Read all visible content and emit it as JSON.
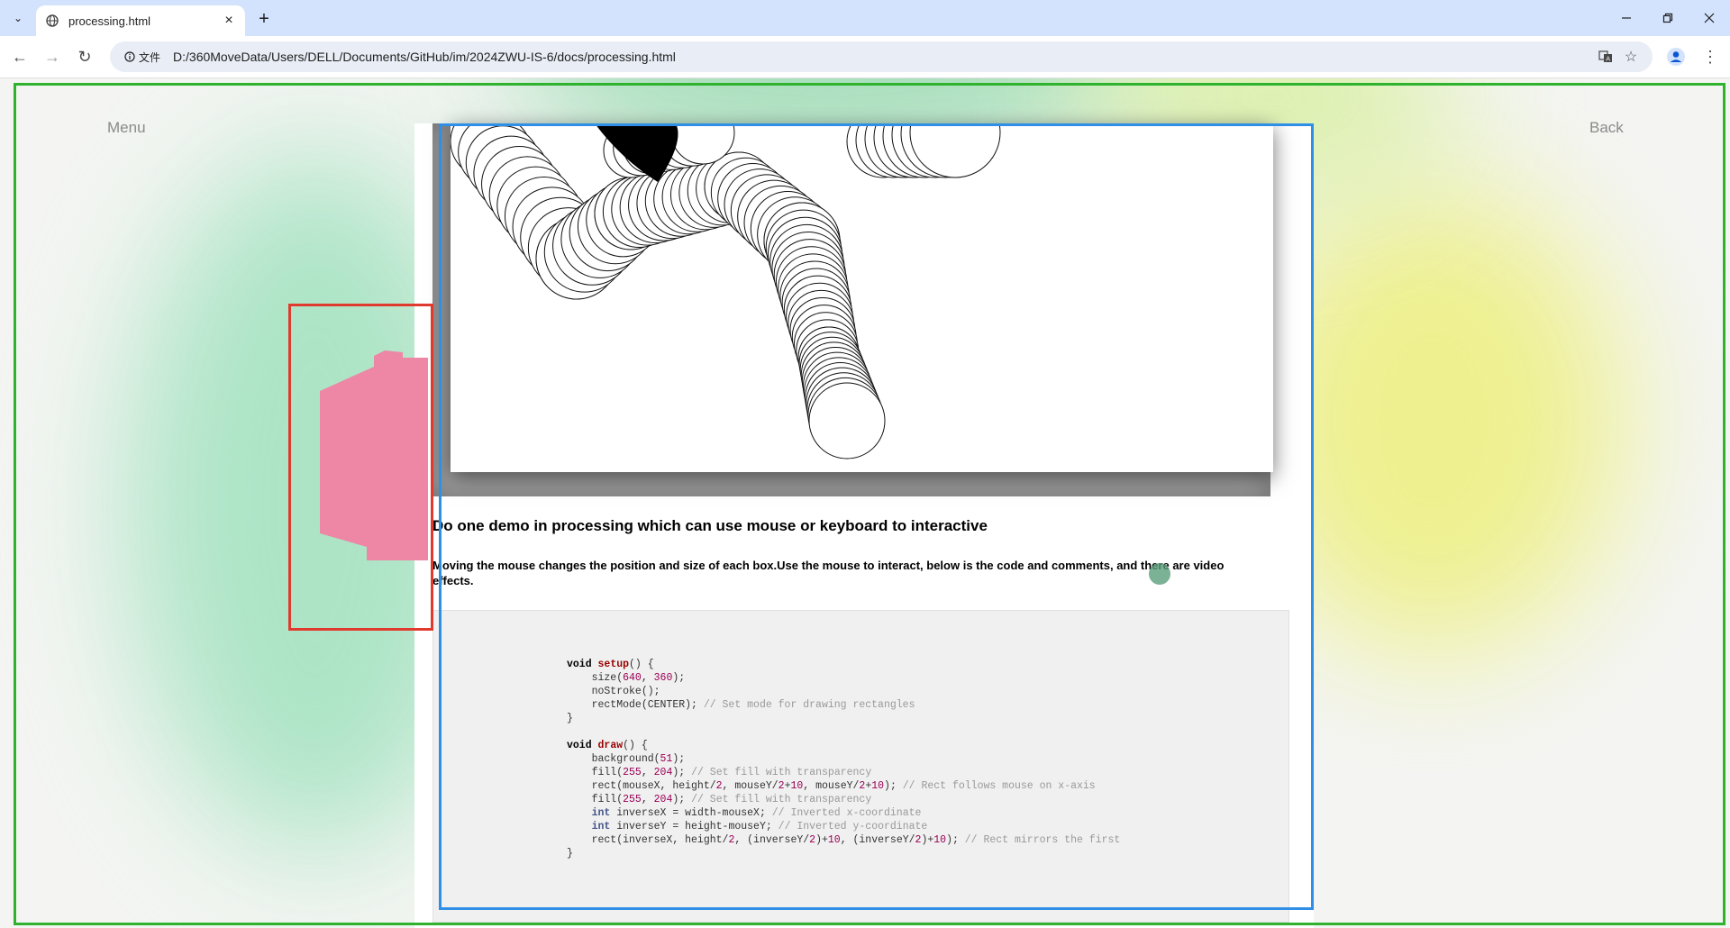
{
  "browser": {
    "tab_title": "processing.html",
    "new_tab_icon": "plus-icon",
    "file_chip": "文件",
    "url": "D:/360MoveData/Users/DELL/Documents/GitHub/im/2024ZWU-IS-6/docs/processing.html"
  },
  "page": {
    "menu_label": "Menu",
    "back_label": "Back",
    "demo_title": "Do one demo in processing which can use mouse or keyboard to interactive",
    "demo_description": "Moving the mouse changes the position and size of each box.Use the mouse to interact, below is the code and comments, and there are video effects.",
    "code": [
      "void setup() {",
      "    size(640, 360);",
      "    noStroke();",
      "    rectMode(CENTER); // Set mode for drawing rectangles",
      "}",
      "",
      "void draw() {",
      "    background(51);",
      "    fill(255, 204); // Set fill with transparency",
      "    rect(mouseX, height/2, mouseY/2+10, mouseY/2+10); // Rect follows mouse on x-axis",
      "    fill(255, 204); // Set fill with transparency",
      "    int inverseX = width-mouseX; // Inverted x-coordinate",
      "    int inverseY = height-mouseY; // Inverted y-coordinate",
      "    rect(inverseX, height/2, (inverseY/2)+10, (inverseY/2)+10); // Rect mirrors the first",
      "}"
    ]
  },
  "colors": {
    "annotation_green": "#2fb32f",
    "annotation_blue": "#2f8fe6",
    "annotation_red": "#e03a2f",
    "sprite_pink": "#ee86a5"
  }
}
